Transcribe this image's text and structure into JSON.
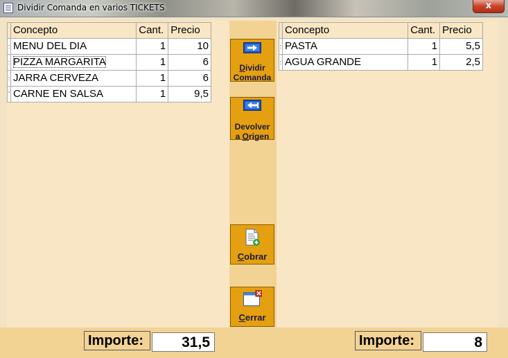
{
  "window": {
    "title": "Dividir Comanda en varios TICKETS",
    "close_glyph": "x"
  },
  "left_grid": {
    "headers": [
      "Concepto",
      "Cant.",
      "Precio"
    ],
    "rows": [
      {
        "indicator": ":",
        "concepto": "MENU DEL DIA",
        "cant": "1",
        "precio": "10"
      },
      {
        "indicator": ":",
        "concepto": "PIZZA MARGARITA",
        "cant": "1",
        "precio": "6"
      },
      {
        "indicator": ":",
        "concepto": "JARRA CERVEZA",
        "cant": "1",
        "precio": "6"
      },
      {
        "indicator": "'",
        "concepto": "CARNE EN SALSA",
        "cant": "1",
        "precio": "9,5"
      }
    ]
  },
  "right_grid": {
    "headers": [
      "Concepto",
      "Cant.",
      "Precio"
    ],
    "rows": [
      {
        "indicator": ":",
        "concepto": "PASTA",
        "cant": "1",
        "precio": "5,5"
      },
      {
        "indicator": ":",
        "concepto": "AGUA GRANDE",
        "cant": "1",
        "precio": "2,5"
      }
    ]
  },
  "buttons": {
    "dividir": {
      "mnemonic": "D",
      "rest": "ividir",
      "line2": "Comanda",
      "icon": "arrow-right-icon"
    },
    "devolver": {
      "line1": "Devolver",
      "line2_pre": "a ",
      "mnemonic": "O",
      "rest": "rigen",
      "icon": "arrow-left-icon"
    },
    "cobrar": {
      "mnemonic": "C",
      "rest": "obrar",
      "icon": "document-add-icon"
    },
    "cerrar": {
      "mnemonic": "C",
      "rest": "errar",
      "icon": "window-close-icon"
    }
  },
  "footer": {
    "left_label": "Importe:",
    "left_value": "31,5",
    "right_label": "Importe:",
    "right_value": "8"
  },
  "colors": {
    "panel": "#f8e6c5",
    "button": "#e4a010",
    "accent_bar": "#f2d394"
  }
}
